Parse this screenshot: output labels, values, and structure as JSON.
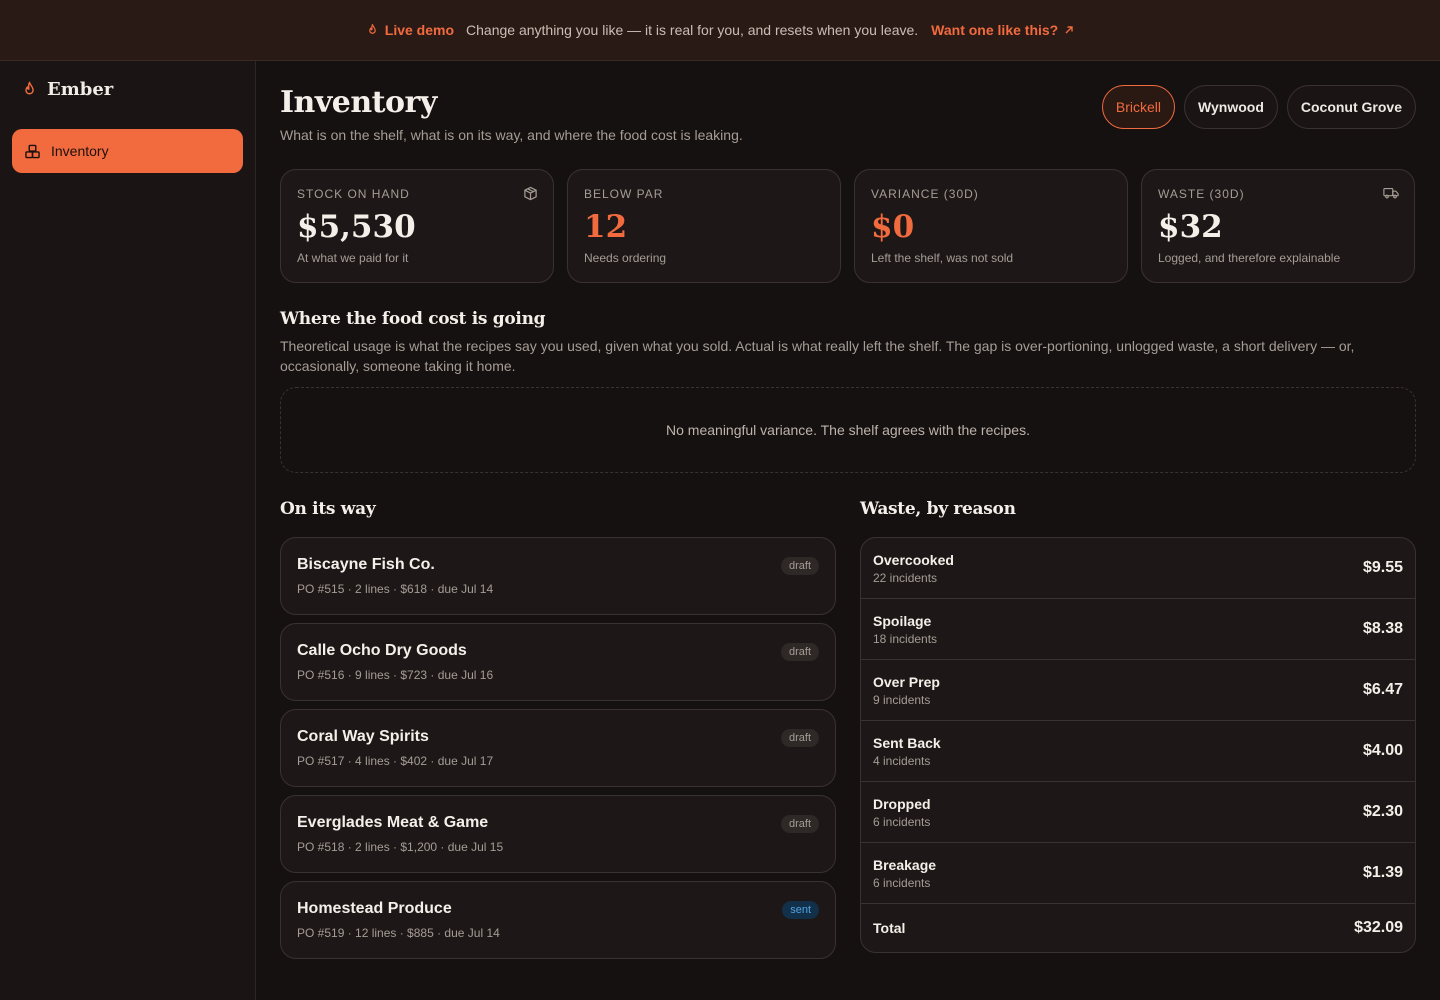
{
  "banner": {
    "live_label": "Live demo",
    "message": "Change anything you like — it is real for you, and resets when you leave.",
    "cta_label": "Want one like this?"
  },
  "sidebar": {
    "brand": "Ember",
    "items": [
      {
        "label": "Inventory",
        "icon": "boxes-icon",
        "active": true
      }
    ]
  },
  "header": {
    "title": "Inventory",
    "subtitle": "What is on the shelf, what is on its way, and where the food cost is leaking.",
    "locations": [
      {
        "label": "Brickell",
        "active": true
      },
      {
        "label": "Wynwood",
        "active": false
      },
      {
        "label": "Coconut Grove",
        "active": false
      }
    ]
  },
  "stats": [
    {
      "label": "STOCK ON HAND",
      "value": "$5,530",
      "note": "At what we paid for it",
      "icon": "package-icon"
    },
    {
      "label": "BELOW PAR",
      "value": "12",
      "note": "Needs ordering"
    },
    {
      "label": "VARIANCE (30D)",
      "value": "$0",
      "note": "Left the shelf, was not sold"
    },
    {
      "label": "WASTE (30D)",
      "value": "$32",
      "note": "Logged, and therefore explainable",
      "icon": "truck-icon"
    }
  ],
  "variance": {
    "title": "Where the food cost is going",
    "description": "Theoretical usage is what the recipes say you used, given what you sold. Actual is what really left the shelf. The gap is over-portioning, unlogged waste, a short delivery — or, occasionally, someone taking it home.",
    "empty_message": "No meaningful variance. The shelf agrees with the recipes."
  },
  "on_its_way": {
    "title": "On its way",
    "orders": [
      {
        "vendor": "Biscayne Fish Co.",
        "meta": "PO #515 · 2 lines · $618 · due Jul 14",
        "status": "draft"
      },
      {
        "vendor": "Calle Ocho Dry Goods",
        "meta": "PO #516 · 9 lines · $723 · due Jul 16",
        "status": "draft"
      },
      {
        "vendor": "Coral Way Spirits",
        "meta": "PO #517 · 4 lines · $402 · due Jul 17",
        "status": "draft"
      },
      {
        "vendor": "Everglades Meat & Game",
        "meta": "PO #518 · 2 lines · $1,200 · due Jul 15",
        "status": "draft"
      },
      {
        "vendor": "Homestead Produce",
        "meta": "PO #519 · 12 lines · $885 · due Jul 14",
        "status": "sent"
      }
    ]
  },
  "waste": {
    "title": "Waste, by reason",
    "rows": [
      {
        "reason": "Overcooked",
        "incidents": "22 incidents",
        "amount": "$9.55"
      },
      {
        "reason": "Spoilage",
        "incidents": "18 incidents",
        "amount": "$8.38"
      },
      {
        "reason": "Over Prep",
        "incidents": "9 incidents",
        "amount": "$6.47"
      },
      {
        "reason": "Sent Back",
        "incidents": "4 incidents",
        "amount": "$4.00"
      },
      {
        "reason": "Dropped",
        "incidents": "6 incidents",
        "amount": "$2.30"
      },
      {
        "reason": "Breakage",
        "incidents": "6 incidents",
        "amount": "$1.39"
      }
    ],
    "total_label": "Total",
    "total_amount": "$32.09"
  },
  "colors": {
    "accent": "#f26b3f",
    "background": "#151110",
    "card": "#1d1817",
    "sent": "#4ea3e3"
  }
}
